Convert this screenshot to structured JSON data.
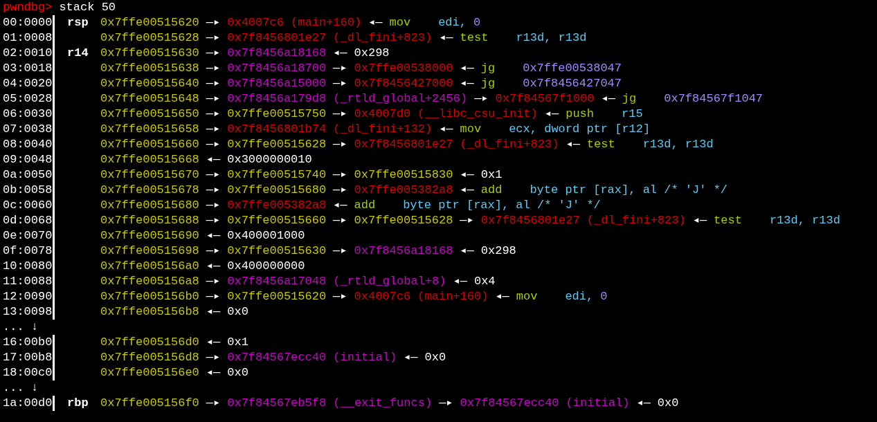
{
  "prompt": {
    "label": "pwndbg>",
    "command": "stack 50"
  },
  "rows": [
    {
      "kind": "entry",
      "offset": "00:0000",
      "register": "rsp",
      "segments": [
        {
          "kind": "stack",
          "text": "0x7ffe00515620"
        },
        {
          "kind": "arrow",
          "text": "—▸"
        },
        {
          "kind": "code",
          "text": "0x4007c6 (main+160)"
        },
        {
          "kind": "arrow",
          "text": "◂—"
        },
        {
          "kind": "mnemonic",
          "text": "mov"
        },
        {
          "kind": "operand",
          "text": "edi,"
        },
        {
          "kind": "immediate",
          "text": "0"
        }
      ]
    },
    {
      "kind": "entry",
      "offset": "01:0008",
      "segments": [
        {
          "kind": "stack",
          "text": "0x7ffe00515628"
        },
        {
          "kind": "arrow",
          "text": "—▸"
        },
        {
          "kind": "code",
          "text": "0x7f8456801e27 (_dl_fini+823)"
        },
        {
          "kind": "arrow",
          "text": "◂—"
        },
        {
          "kind": "mnemonic",
          "text": "test"
        },
        {
          "kind": "operand",
          "text": "r13d, r13d"
        }
      ]
    },
    {
      "kind": "entry",
      "offset": "02:0010",
      "register": "r14",
      "segments": [
        {
          "kind": "stack",
          "text": "0x7ffe00515630"
        },
        {
          "kind": "arrow",
          "text": "—▸"
        },
        {
          "kind": "data",
          "text": "0x7f8456a18168"
        },
        {
          "kind": "arrow",
          "text": "◂—"
        },
        {
          "kind": "value",
          "text": "0x298"
        }
      ]
    },
    {
      "kind": "entry",
      "offset": "03:0018",
      "segments": [
        {
          "kind": "stack",
          "text": "0x7ffe00515638"
        },
        {
          "kind": "arrow",
          "text": "—▸"
        },
        {
          "kind": "data",
          "text": "0x7f8456a18700"
        },
        {
          "kind": "arrow",
          "text": "—▸"
        },
        {
          "kind": "code",
          "text": "0x7ffe00538000"
        },
        {
          "kind": "arrow",
          "text": "◂—"
        },
        {
          "kind": "mnemonic",
          "text": "jg"
        },
        {
          "kind": "immediate",
          "text": "0x7ffe00538047"
        }
      ]
    },
    {
      "kind": "entry",
      "offset": "04:0020",
      "segments": [
        {
          "kind": "stack",
          "text": "0x7ffe00515640"
        },
        {
          "kind": "arrow",
          "text": "—▸"
        },
        {
          "kind": "data",
          "text": "0x7f8456a15000"
        },
        {
          "kind": "arrow",
          "text": "—▸"
        },
        {
          "kind": "code",
          "text": "0x7f8456427000"
        },
        {
          "kind": "arrow",
          "text": "◂—"
        },
        {
          "kind": "mnemonic",
          "text": "jg"
        },
        {
          "kind": "immediate",
          "text": "0x7f8456427047"
        }
      ]
    },
    {
      "kind": "entry",
      "offset": "05:0028",
      "segments": [
        {
          "kind": "stack",
          "text": "0x7ffe00515648"
        },
        {
          "kind": "arrow",
          "text": "—▸"
        },
        {
          "kind": "data",
          "text": "0x7f8456a179d8 (_rtld_global+2456)"
        },
        {
          "kind": "arrow",
          "text": "—▸"
        },
        {
          "kind": "code",
          "text": "0x7f84567f1000"
        },
        {
          "kind": "arrow",
          "text": "◂—"
        },
        {
          "kind": "mnemonic",
          "text": "jg"
        },
        {
          "kind": "immediate",
          "text": "0x7f84567f1047"
        }
      ]
    },
    {
      "kind": "entry",
      "offset": "06:0030",
      "segments": [
        {
          "kind": "stack",
          "text": "0x7ffe00515650"
        },
        {
          "kind": "arrow",
          "text": "—▸"
        },
        {
          "kind": "stack",
          "text": "0x7ffe00515750"
        },
        {
          "kind": "arrow",
          "text": "—▸"
        },
        {
          "kind": "code",
          "text": "0x4007d0 (__libc_csu_init)"
        },
        {
          "kind": "arrow",
          "text": "◂—"
        },
        {
          "kind": "mnemonic",
          "text": "push"
        },
        {
          "kind": "operand",
          "text": "r15"
        }
      ]
    },
    {
      "kind": "entry",
      "offset": "07:0038",
      "segments": [
        {
          "kind": "stack",
          "text": "0x7ffe00515658"
        },
        {
          "kind": "arrow",
          "text": "—▸"
        },
        {
          "kind": "code",
          "text": "0x7f8456801b74 (_dl_fini+132)"
        },
        {
          "kind": "arrow",
          "text": "◂—"
        },
        {
          "kind": "mnemonic",
          "text": "mov"
        },
        {
          "kind": "operand",
          "text": "ecx, dword ptr [r12]"
        }
      ]
    },
    {
      "kind": "entry",
      "offset": "08:0040",
      "segments": [
        {
          "kind": "stack",
          "text": "0x7ffe00515660"
        },
        {
          "kind": "arrow",
          "text": "—▸"
        },
        {
          "kind": "stack",
          "text": "0x7ffe00515628"
        },
        {
          "kind": "arrow",
          "text": "—▸"
        },
        {
          "kind": "code",
          "text": "0x7f8456801e27 (_dl_fini+823)"
        },
        {
          "kind": "arrow",
          "text": "◂—"
        },
        {
          "kind": "mnemonic",
          "text": "test"
        },
        {
          "kind": "operand",
          "text": "r13d, r13d"
        }
      ]
    },
    {
      "kind": "entry",
      "offset": "09:0048",
      "segments": [
        {
          "kind": "stack",
          "text": "0x7ffe00515668"
        },
        {
          "kind": "arrow",
          "text": "◂—"
        },
        {
          "kind": "value",
          "text": "0x3000000010"
        }
      ]
    },
    {
      "kind": "entry",
      "offset": "0a:0050",
      "segments": [
        {
          "kind": "stack",
          "text": "0x7ffe00515670"
        },
        {
          "kind": "arrow",
          "text": "—▸"
        },
        {
          "kind": "stack",
          "text": "0x7ffe00515740"
        },
        {
          "kind": "arrow",
          "text": "—▸"
        },
        {
          "kind": "stack",
          "text": "0x7ffe00515830"
        },
        {
          "kind": "arrow",
          "text": "◂—"
        },
        {
          "kind": "value",
          "text": "0x1"
        }
      ]
    },
    {
      "kind": "entry",
      "offset": "0b:0058",
      "segments": [
        {
          "kind": "stack",
          "text": "0x7ffe00515678"
        },
        {
          "kind": "arrow",
          "text": "—▸"
        },
        {
          "kind": "stack",
          "text": "0x7ffe00515680"
        },
        {
          "kind": "arrow",
          "text": "—▸"
        },
        {
          "kind": "code",
          "text": "0x7ffe005382a8"
        },
        {
          "kind": "arrow",
          "text": "◂—"
        },
        {
          "kind": "mnemonic",
          "text": "add"
        },
        {
          "kind": "operand",
          "text": "byte ptr [rax], al /* 'J' */"
        }
      ]
    },
    {
      "kind": "entry",
      "offset": "0c:0060",
      "segments": [
        {
          "kind": "stack",
          "text": "0x7ffe00515680"
        },
        {
          "kind": "arrow",
          "text": "—▸"
        },
        {
          "kind": "code",
          "text": "0x7ffe005382a8"
        },
        {
          "kind": "arrow",
          "text": "◂—"
        },
        {
          "kind": "mnemonic",
          "text": "add"
        },
        {
          "kind": "operand",
          "text": "byte ptr [rax], al /* 'J' */"
        }
      ]
    },
    {
      "kind": "entry",
      "offset": "0d:0068",
      "segments": [
        {
          "kind": "stack",
          "text": "0x7ffe00515688"
        },
        {
          "kind": "arrow",
          "text": "—▸"
        },
        {
          "kind": "stack",
          "text": "0x7ffe00515660"
        },
        {
          "kind": "arrow",
          "text": "—▸"
        },
        {
          "kind": "stack",
          "text": "0x7ffe00515628"
        },
        {
          "kind": "arrow",
          "text": "—▸"
        },
        {
          "kind": "code",
          "text": "0x7f8456801e27 (_dl_fini+823)"
        },
        {
          "kind": "arrow",
          "text": "◂—"
        },
        {
          "kind": "mnemonic",
          "text": "test"
        },
        {
          "kind": "operand",
          "text": "r13d, r13d"
        }
      ]
    },
    {
      "kind": "entry",
      "offset": "0e:0070",
      "segments": [
        {
          "kind": "stack",
          "text": "0x7ffe00515690"
        },
        {
          "kind": "arrow",
          "text": "◂—"
        },
        {
          "kind": "value",
          "text": "0x400001000"
        }
      ]
    },
    {
      "kind": "entry",
      "offset": "0f:0078",
      "segments": [
        {
          "kind": "stack",
          "text": "0x7ffe00515698"
        },
        {
          "kind": "arrow",
          "text": "—▸"
        },
        {
          "kind": "stack",
          "text": "0x7ffe00515630"
        },
        {
          "kind": "arrow",
          "text": "—▸"
        },
        {
          "kind": "data",
          "text": "0x7f8456a18168"
        },
        {
          "kind": "arrow",
          "text": "◂—"
        },
        {
          "kind": "value",
          "text": "0x298"
        }
      ]
    },
    {
      "kind": "entry",
      "offset": "10:0080",
      "segments": [
        {
          "kind": "stack",
          "text": "0x7ffe005156a0"
        },
        {
          "kind": "arrow",
          "text": "◂—"
        },
        {
          "kind": "value",
          "text": "0x400000000"
        }
      ]
    },
    {
      "kind": "entry",
      "offset": "11:0088",
      "segments": [
        {
          "kind": "stack",
          "text": "0x7ffe005156a8"
        },
        {
          "kind": "arrow",
          "text": "—▸"
        },
        {
          "kind": "data",
          "text": "0x7f8456a17048 (_rtld_global+8)"
        },
        {
          "kind": "arrow",
          "text": "◂—"
        },
        {
          "kind": "value",
          "text": "0x4"
        }
      ]
    },
    {
      "kind": "entry",
      "offset": "12:0090",
      "segments": [
        {
          "kind": "stack",
          "text": "0x7ffe005156b0"
        },
        {
          "kind": "arrow",
          "text": "—▸"
        },
        {
          "kind": "stack",
          "text": "0x7ffe00515620"
        },
        {
          "kind": "arrow",
          "text": "—▸"
        },
        {
          "kind": "code",
          "text": "0x4007c6 (main+160)"
        },
        {
          "kind": "arrow",
          "text": "◂—"
        },
        {
          "kind": "mnemonic",
          "text": "mov"
        },
        {
          "kind": "operand",
          "text": "edi,"
        },
        {
          "kind": "immediate",
          "text": "0"
        }
      ]
    },
    {
      "kind": "entry",
      "offset": "13:0098",
      "segments": [
        {
          "kind": "stack",
          "text": "0x7ffe005156b8"
        },
        {
          "kind": "arrow",
          "text": "◂—"
        },
        {
          "kind": "value",
          "text": "0x0"
        }
      ]
    },
    {
      "kind": "skip",
      "offset": "... ↓"
    },
    {
      "kind": "entry",
      "offset": "16:00b0",
      "segments": [
        {
          "kind": "stack",
          "text": "0x7ffe005156d0"
        },
        {
          "kind": "arrow",
          "text": "◂—"
        },
        {
          "kind": "value",
          "text": "0x1"
        }
      ]
    },
    {
      "kind": "entry",
      "offset": "17:00b8",
      "segments": [
        {
          "kind": "stack",
          "text": "0x7ffe005156d8"
        },
        {
          "kind": "arrow",
          "text": "—▸"
        },
        {
          "kind": "data",
          "text": "0x7f84567ecc40 (initial)"
        },
        {
          "kind": "arrow",
          "text": "◂—"
        },
        {
          "kind": "value",
          "text": "0x0"
        }
      ]
    },
    {
      "kind": "entry",
      "offset": "18:00c0",
      "segments": [
        {
          "kind": "stack",
          "text": "0x7ffe005156e0"
        },
        {
          "kind": "arrow",
          "text": "◂—"
        },
        {
          "kind": "value",
          "text": "0x0"
        }
      ]
    },
    {
      "kind": "skip",
      "offset": "... ↓"
    },
    {
      "kind": "entry",
      "offset": "1a:00d0",
      "register": "rbp",
      "segments": [
        {
          "kind": "stack",
          "text": "0x7ffe005156f0"
        },
        {
          "kind": "arrow",
          "text": "—▸"
        },
        {
          "kind": "data",
          "text": "0x7f84567eb5f8 (__exit_funcs)"
        },
        {
          "kind": "arrow",
          "text": "—▸"
        },
        {
          "kind": "data",
          "text": "0x7f84567ecc40 (initial)"
        },
        {
          "kind": "arrow",
          "text": "◂—"
        },
        {
          "kind": "value",
          "text": "0x0"
        }
      ]
    }
  ]
}
